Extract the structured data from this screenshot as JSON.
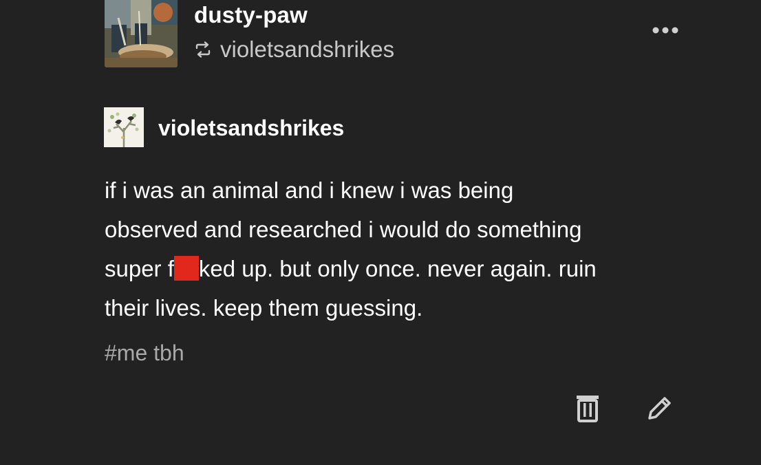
{
  "reblog_header": {
    "blog_name": "dusty-paw",
    "reblogged_from": "violetsandshrikes",
    "avatar_icon": "blog-avatar-painting",
    "reblog_icon": "reblog-icon",
    "more_icon": "more-options-icon"
  },
  "source_post": {
    "blog_name": "violetsandshrikes",
    "avatar_icon": "blog-avatar-birds",
    "body": {
      "line1": "if i was an animal and i knew i was being",
      "line2": "observed and researched i would do something",
      "line3_before": "super f",
      "line3_after": "ked up. but only once. never again. ruin",
      "line4": "their lives. keep them guessing."
    },
    "tags": "#me tbh"
  },
  "footer": {
    "delete_icon": "trash-icon",
    "edit_icon": "pencil-icon"
  },
  "colors": {
    "background": "#222222",
    "text": "#ffffff",
    "secondary_text": "#c8c8c8",
    "tag_text": "#a9a9a9",
    "censor_block": "#e2281c"
  }
}
